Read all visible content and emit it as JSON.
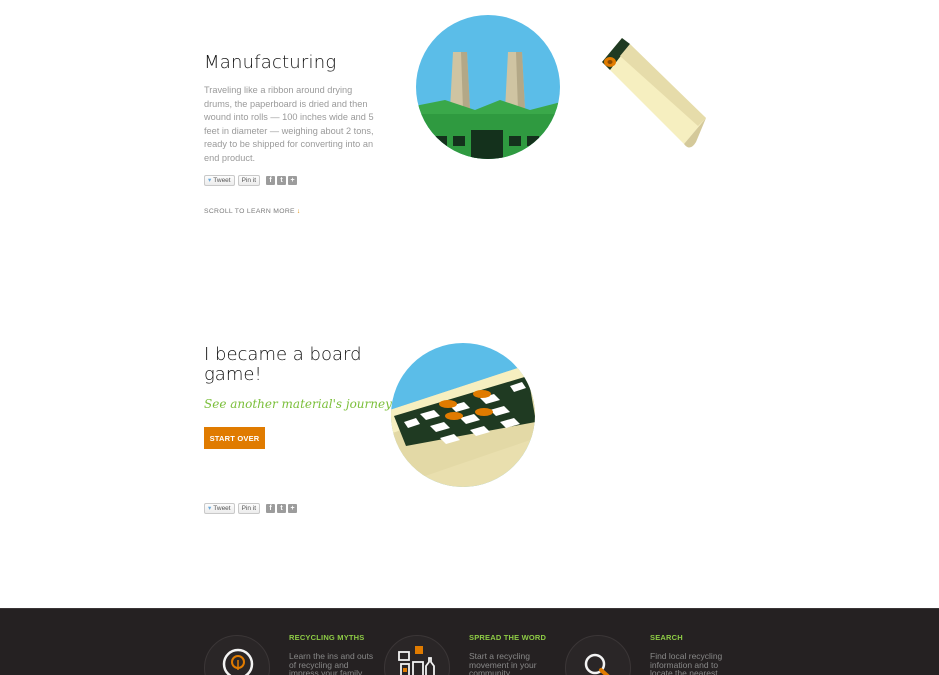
{
  "sections": [
    {
      "title": "Manufacturing",
      "body": "Traveling like a ribbon around drying drums, the paperboard is dried and then wound into rolls — 100 inches wide and 5 feet in diameter — weighing about 2 tons, ready to be shipped for converting into an end product.",
      "scroll_label": "SCROLL TO LEARN MORE",
      "scroll_arrow": "↓"
    },
    {
      "title": "I became a board game!",
      "tagline": "See another material's journey!",
      "cta_label": "START OVER"
    }
  ],
  "social": {
    "tweet_label": "Tweet",
    "pin_label": "Pin it",
    "icons": [
      "facebook-icon",
      "tumblr-icon",
      "plus-icon"
    ]
  },
  "footer": {
    "columns": [
      {
        "heading": "RECYCLING MYTHS",
        "text": "Learn the ins and outs of recycling and impress your family",
        "icon": "lightbulb-icon"
      },
      {
        "heading": "SPREAD THE WORD",
        "text": "Start a recycling movement in your community",
        "icon": "recyclables-icon"
      },
      {
        "heading": "SEARCH",
        "text": "Find local recycling information and to locate the nearest",
        "icon": "magnifier-icon"
      }
    ]
  },
  "colors": {
    "accent_orange": "#e07b00",
    "accent_green": "#7bbf3a",
    "footer_bg": "#252122",
    "sky_blue": "#5bbde8"
  }
}
